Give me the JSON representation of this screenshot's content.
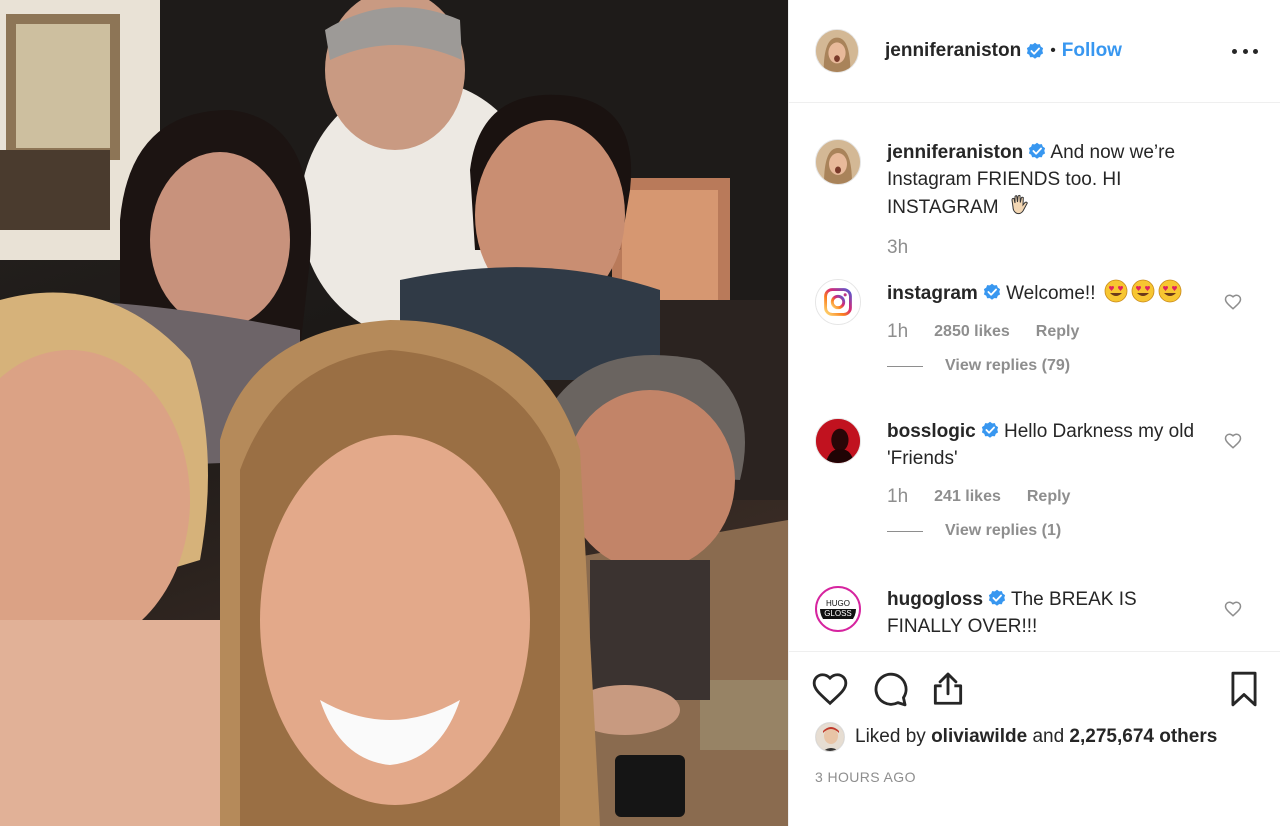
{
  "post": {
    "author": "jenniferaniston",
    "separator": "•",
    "follow_label": "Follow",
    "caption_text": "And now we’re Instagram FRIENDS too. HI INSTAGRAM",
    "caption_time": "3h"
  },
  "comments": [
    {
      "username": "instagram",
      "text": "Welcome!!",
      "time": "1h",
      "likes": "2850 likes",
      "reply_label": "Reply",
      "view_replies": "View replies (79)"
    },
    {
      "username": "bosslogic",
      "text": "Hello Darkness my old 'Friends'",
      "time": "1h",
      "likes": "241 likes",
      "reply_label": "Reply",
      "view_replies": "View replies (1)"
    },
    {
      "username": "hugogloss",
      "text": "The BREAK IS FINALLY OVER!!!",
      "avatar_text_1": "HUGO",
      "avatar_text_2": "GLOSS"
    }
  ],
  "footer": {
    "liked_by_prefix": "Liked by",
    "liked_by_user": "oliviawilde",
    "liked_by_and": "and",
    "liked_by_count": "2,275,674 others",
    "posted_ago": "3 HOURS AGO"
  },
  "colors": {
    "accent": "#3897f0",
    "text": "#262626",
    "muted": "#8e8e8e",
    "emoji_yellow": "#f7c631",
    "emoji_heart": "#e0245e"
  },
  "icons": [
    "verified-badge-icon",
    "more-options-icon",
    "heart-icon",
    "comment-icon",
    "share-icon",
    "bookmark-icon",
    "waving-hand-icon",
    "heart-eyes-emoji-icon"
  ]
}
